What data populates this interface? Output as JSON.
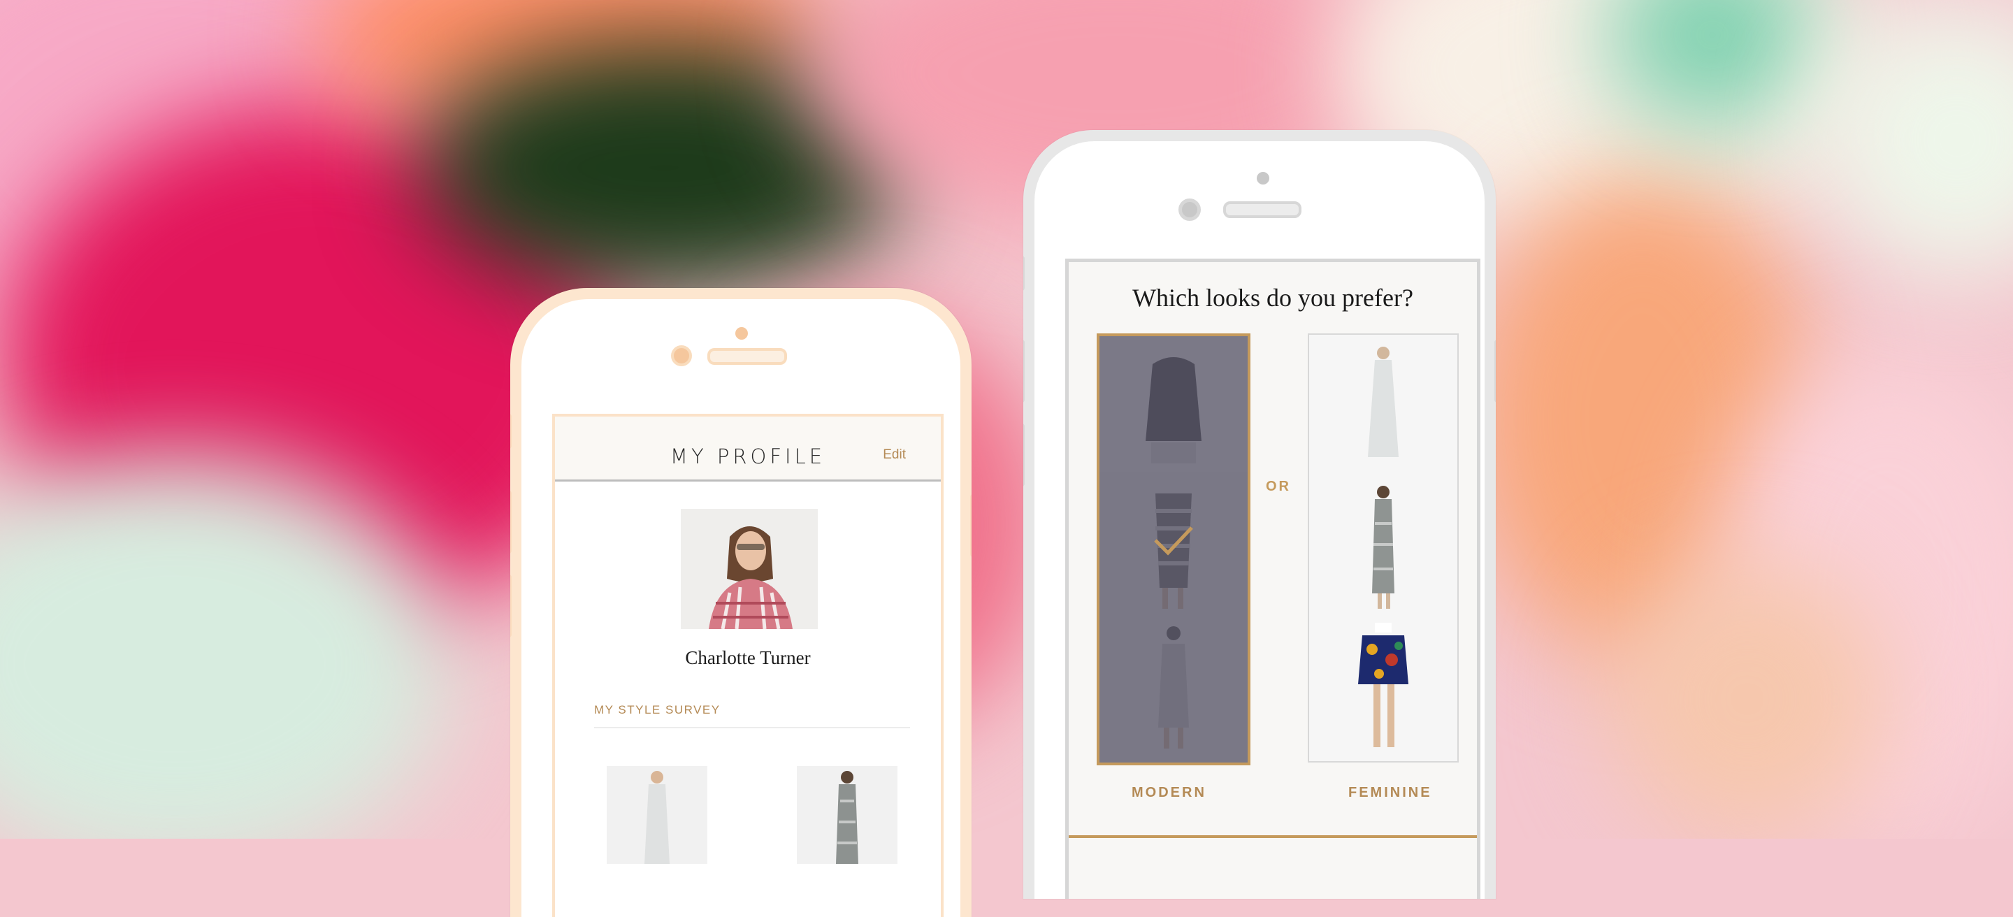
{
  "left_phone": {
    "header": {
      "title": "MY PROFILE",
      "edit_label": "Edit"
    },
    "profile": {
      "name": "Charlotte Turner"
    },
    "survey": {
      "label": "MY STYLE SURVEY"
    }
  },
  "right_phone": {
    "question": "Which looks do you prefer?",
    "divider_text": "OR",
    "options": [
      {
        "label": "MODERN",
        "selected": true
      },
      {
        "label": "FEMININE",
        "selected": false
      }
    ]
  },
  "colors": {
    "accent": "#c59a5c",
    "selected_overlay": "#585668",
    "left_phone_frame": "#fde6cf",
    "right_phone_frame": "#e7e7e7"
  },
  "icons": [
    "checkmark-icon"
  ]
}
